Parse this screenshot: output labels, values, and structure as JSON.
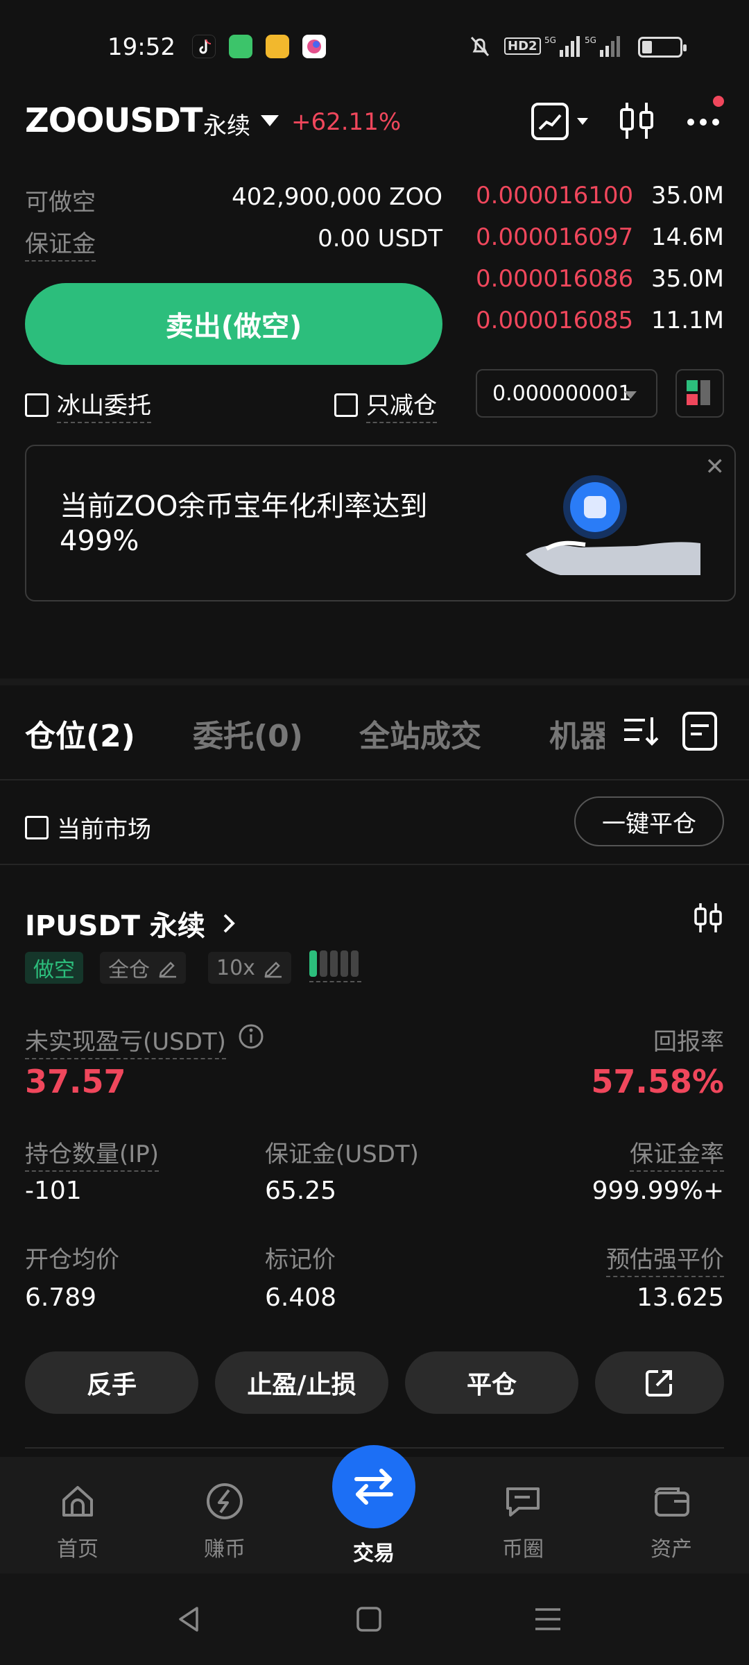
{
  "status_bar": {
    "time": "19:52",
    "apps": [
      "tiktok-icon",
      "android-app-icon",
      "notes-app-icon",
      "browser-app-icon"
    ],
    "network": [
      "HD2",
      "5G",
      "5G"
    ]
  },
  "header": {
    "symbol": "ZOOUSDT",
    "contract_type": "永续",
    "change": "+62.11%",
    "notification_dot_color": "#f0475c"
  },
  "order_panel": {
    "available_short_label": "可做空",
    "available_short_value": "402,900,000 ZOO",
    "margin_label": "保证金",
    "margin_value": "0.00 USDT",
    "sell_button": "卖出(做空)",
    "iceberg_label": "冰山委托",
    "reduce_only_label": "只减仓"
  },
  "order_book": {
    "asks": [
      {
        "price": "0.000016100",
        "size": "35.0M"
      },
      {
        "price": "0.000016097",
        "size": "14.6M"
      },
      {
        "price": "0.000016086",
        "size": "35.0M"
      },
      {
        "price": "0.000016085",
        "size": "11.1M"
      }
    ],
    "tick_size": "0.000000001"
  },
  "banner": {
    "text": "当前ZOO余币宝年化利率达到499%"
  },
  "tabs": [
    {
      "label": "仓位(2)",
      "active": true
    },
    {
      "label": "委托(0)",
      "active": false
    },
    {
      "label": "全站成交",
      "active": false
    },
    {
      "label": "机器",
      "active": false
    }
  ],
  "filter": {
    "current_market_label": "当前市场",
    "close_all_button": "一键平仓"
  },
  "position": {
    "title": "IPUSDT 永续",
    "side_tag": "做空",
    "margin_mode": "全仓",
    "leverage": "10x",
    "risk_level": 1,
    "risk_level_max": 5,
    "pnl_label": "未实现盈亏(USDT)",
    "pnl_value": "37.57",
    "roe_label": "回报率",
    "roe_value": "57.58%",
    "qty_label": "持仓数量(IP)",
    "qty_value": "-101",
    "margin_label": "保证金(USDT)",
    "margin_value": "65.25",
    "margin_ratio_label": "保证金率",
    "margin_ratio_value": "999.99%+",
    "entry_label": "开仓均价",
    "entry_value": "6.789",
    "mark_label": "标记价",
    "mark_value": "6.408",
    "liq_label": "预估强平价",
    "liq_value": "13.625"
  },
  "actions": {
    "reverse": "反手",
    "tp_sl": "止盈/止损",
    "close": "平仓"
  },
  "bottom_nav": [
    {
      "label": "首页",
      "icon": "home-icon"
    },
    {
      "label": "赚币",
      "icon": "earn-icon"
    },
    {
      "label": "交易",
      "icon": "trade-icon"
    },
    {
      "label": "币圈",
      "icon": "chat-icon"
    },
    {
      "label": "资产",
      "icon": "wallet-icon"
    }
  ],
  "colors": {
    "red": "#f0475c",
    "green": "#2cbe7c",
    "accent_blue": "#1c6ff5",
    "background": "#121212"
  }
}
